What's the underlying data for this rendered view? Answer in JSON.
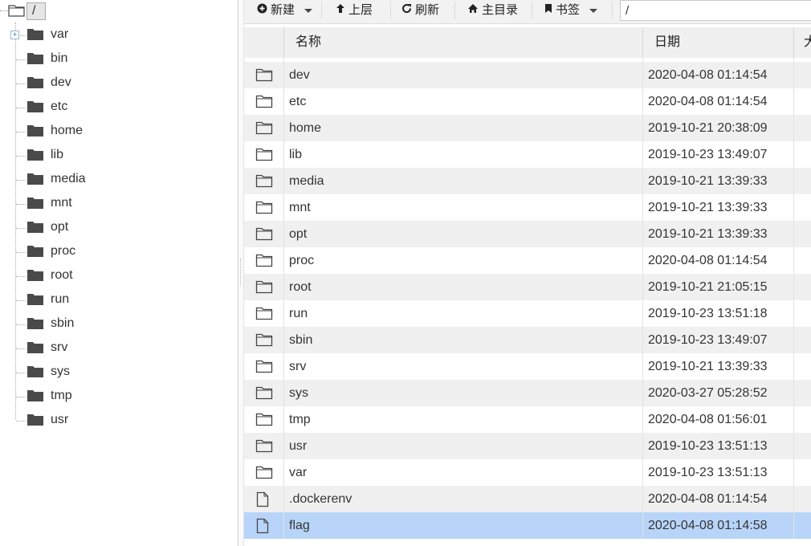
{
  "tree": {
    "root_label": "/",
    "items": [
      {
        "label": "var",
        "expandable": true
      },
      {
        "label": "bin"
      },
      {
        "label": "dev"
      },
      {
        "label": "etc"
      },
      {
        "label": "home"
      },
      {
        "label": "lib"
      },
      {
        "label": "media"
      },
      {
        "label": "mnt"
      },
      {
        "label": "opt"
      },
      {
        "label": "proc"
      },
      {
        "label": "root"
      },
      {
        "label": "run"
      },
      {
        "label": "sbin"
      },
      {
        "label": "srv"
      },
      {
        "label": "sys"
      },
      {
        "label": "tmp"
      },
      {
        "label": "usr"
      }
    ]
  },
  "toolbar": {
    "new_label": "新建",
    "up_label": "上层",
    "refresh_label": "刷新",
    "home_label": "主目录",
    "bookmark_label": "书签",
    "path_value": "/"
  },
  "grid": {
    "columns": {
      "name": "名称",
      "date": "日期",
      "size": "大"
    },
    "rows": [
      {
        "type": "folder",
        "name": "dev",
        "date": "2020-04-08 01:14:54"
      },
      {
        "type": "folder",
        "name": "etc",
        "date": "2020-04-08 01:14:54"
      },
      {
        "type": "folder",
        "name": "home",
        "date": "2019-10-21 20:38:09"
      },
      {
        "type": "folder",
        "name": "lib",
        "date": "2019-10-23 13:49:07"
      },
      {
        "type": "folder",
        "name": "media",
        "date": "2019-10-21 13:39:33"
      },
      {
        "type": "folder",
        "name": "mnt",
        "date": "2019-10-21 13:39:33"
      },
      {
        "type": "folder",
        "name": "opt",
        "date": "2019-10-21 13:39:33"
      },
      {
        "type": "folder",
        "name": "proc",
        "date": "2020-04-08 01:14:54"
      },
      {
        "type": "folder",
        "name": "root",
        "date": "2019-10-21 21:05:15"
      },
      {
        "type": "folder",
        "name": "run",
        "date": "2019-10-23 13:51:18"
      },
      {
        "type": "folder",
        "name": "sbin",
        "date": "2019-10-23 13:49:07"
      },
      {
        "type": "folder",
        "name": "srv",
        "date": "2019-10-21 13:39:33"
      },
      {
        "type": "folder",
        "name": "sys",
        "date": "2020-03-27 05:28:52"
      },
      {
        "type": "folder",
        "name": "tmp",
        "date": "2020-04-08 01:56:01"
      },
      {
        "type": "folder",
        "name": "usr",
        "date": "2019-10-23 13:51:13"
      },
      {
        "type": "folder",
        "name": "var",
        "date": "2019-10-23 13:51:13"
      },
      {
        "type": "file",
        "name": ".dockerenv",
        "date": "2020-04-08 01:14:54"
      },
      {
        "type": "file",
        "name": "flag",
        "date": "2020-04-08 01:14:58",
        "selected": true
      }
    ]
  },
  "colors": {
    "selected_row": "#b8d5f9",
    "alt_row": "#f0f0f0",
    "toolbar_bg": "#f2f2f2"
  }
}
